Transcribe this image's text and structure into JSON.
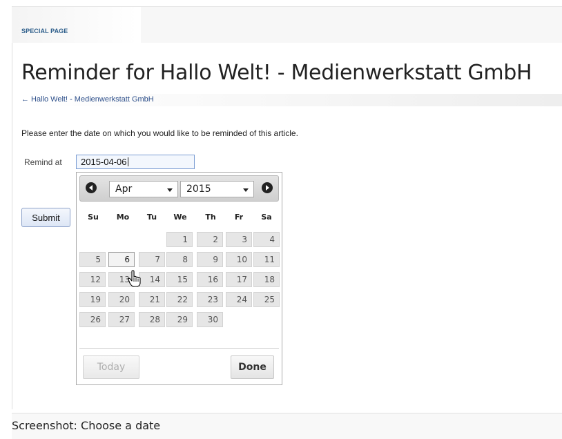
{
  "page": {
    "tag": "SPECIAL PAGE",
    "title": "Reminder for Hallo Welt! - Medienwerkstatt GmbH",
    "back_link": "← Hallo Welt! - Medienwerkstatt GmbH",
    "intro": "Please enter the date on which you would like to be reminded of this article."
  },
  "form": {
    "remind_label": "Remind at",
    "date_value": "2015-04-06",
    "submit_label": "Submit"
  },
  "datepicker": {
    "month": "Apr",
    "year": "2015",
    "weekdays": [
      "Su",
      "Mo",
      "Tu",
      "We",
      "Th",
      "Fr",
      "Sa"
    ],
    "weeks": [
      [
        "",
        "",
        "",
        "1",
        "2",
        "3",
        "4"
      ],
      [
        "5",
        "6",
        "7",
        "8",
        "9",
        "10",
        "11"
      ],
      [
        "12",
        "13",
        "14",
        "15",
        "16",
        "17",
        "18"
      ],
      [
        "19",
        "20",
        "21",
        "22",
        "23",
        "24",
        "25"
      ],
      [
        "26",
        "27",
        "28",
        "29",
        "30",
        "",
        ""
      ]
    ],
    "selected_day": "6",
    "today_label": "Today",
    "done_label": "Done"
  },
  "caption": "Screenshot: Choose a date"
}
